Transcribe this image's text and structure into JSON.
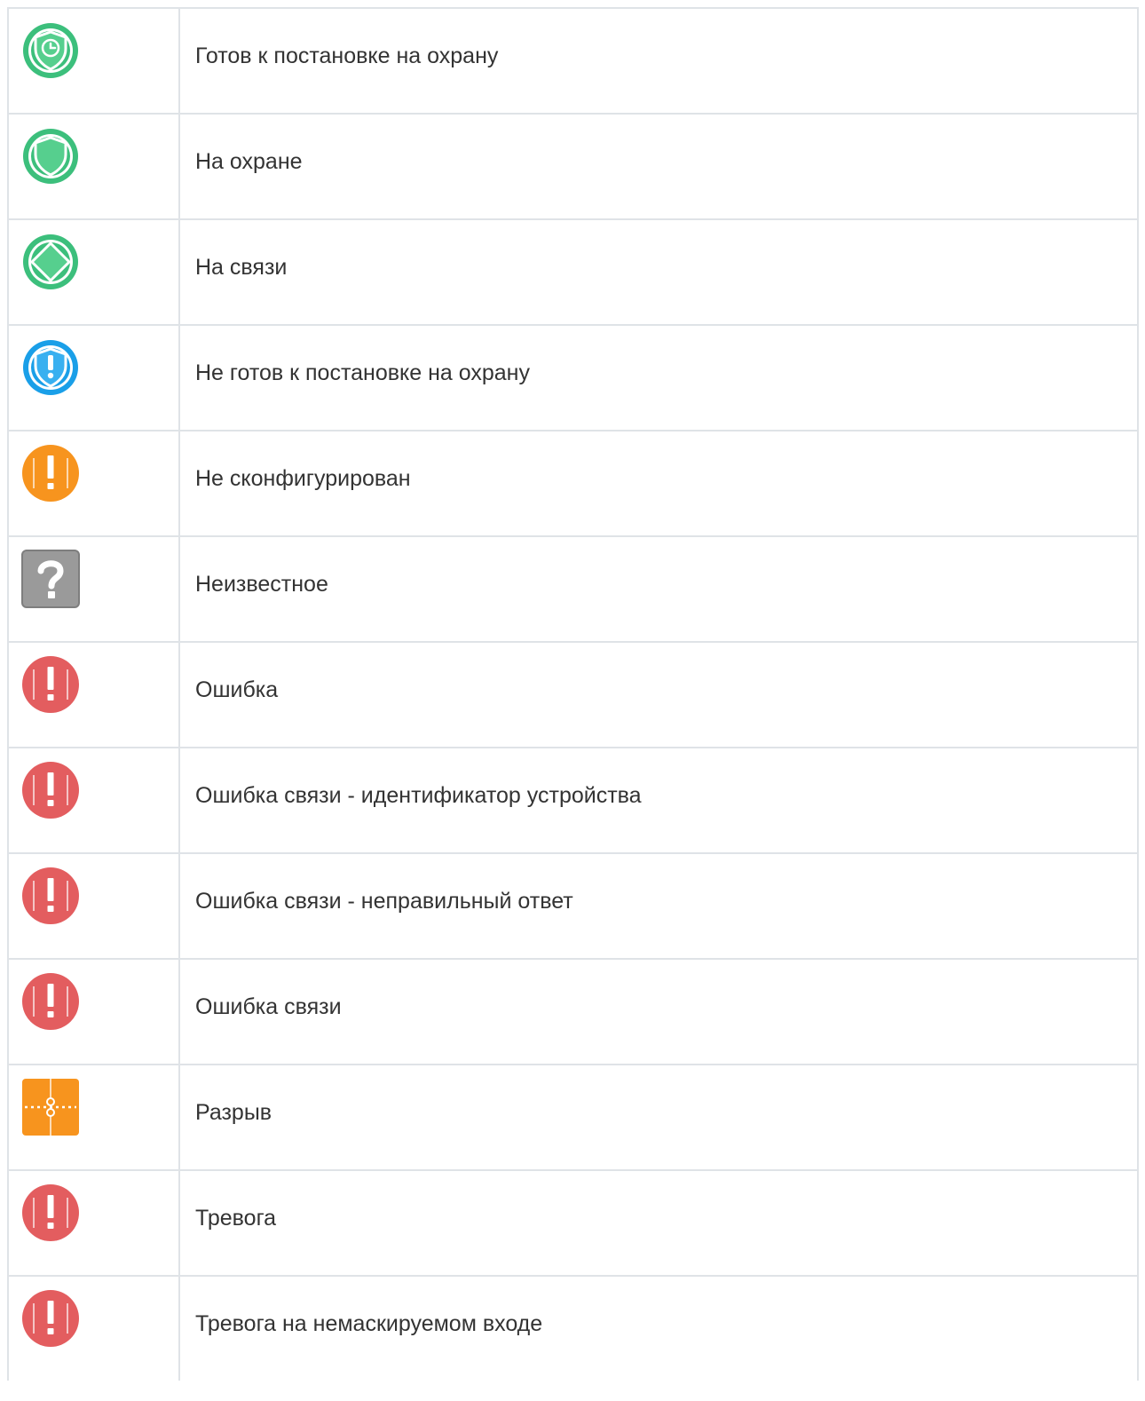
{
  "colors": {
    "green": "#3cbf7c",
    "blue": "#1a9fe8",
    "orange": "#f7941e",
    "red": "#e35d5f",
    "gray": "#9a9a9a",
    "border": "#dfe3e7",
    "text": "#333333"
  },
  "statuses": [
    {
      "icon": "shield-clock-icon",
      "label": "Готов к постановке на охрану"
    },
    {
      "icon": "shield-icon",
      "label": "На охране"
    },
    {
      "icon": "diamond-icon",
      "label": "На связи"
    },
    {
      "icon": "shield-exclamation-icon",
      "label": "Не готов к постановке на охрану"
    },
    {
      "icon": "orange-exclamation-icon",
      "label": "Не сконфигурирован"
    },
    {
      "icon": "question-icon",
      "label": "Неизвестное"
    },
    {
      "icon": "red-exclamation-icon",
      "label": "Ошибка"
    },
    {
      "icon": "red-exclamation-icon",
      "label": "Ошибка связи - идентификатор устройства"
    },
    {
      "icon": "red-exclamation-icon",
      "label": "Ошибка связи - неправильный ответ"
    },
    {
      "icon": "red-exclamation-icon",
      "label": "Ошибка связи"
    },
    {
      "icon": "break-icon",
      "label": "Разрыв"
    },
    {
      "icon": "red-exclamation-icon",
      "label": "Тревога"
    },
    {
      "icon": "red-exclamation-icon",
      "label": "Тревога на немаскируемом входе"
    }
  ]
}
